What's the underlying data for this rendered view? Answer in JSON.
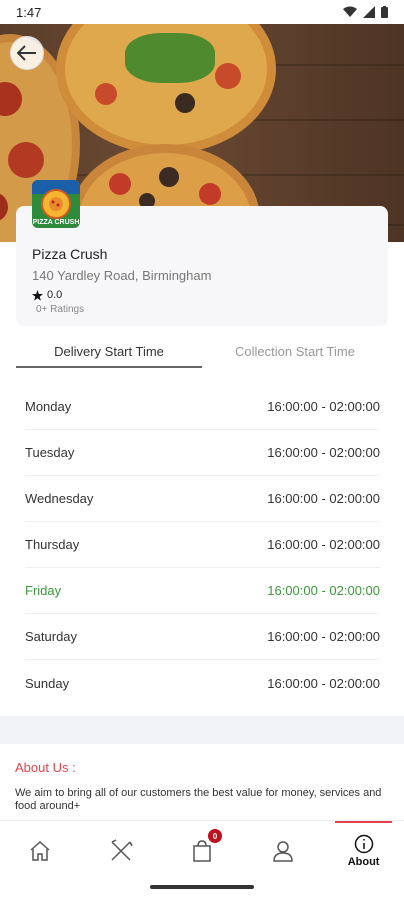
{
  "status_bar": {
    "time": "1:47",
    "icons": [
      "wifi-icon",
      "signal-icon",
      "battery-icon"
    ]
  },
  "hero": {
    "image": "pizza-banner",
    "back_icon": "arrow-left-icon"
  },
  "restaurant": {
    "logo_text": "PIZZA CRUSH",
    "name": "Pizza Crush",
    "address": "140 Yardley Road, Birmingham",
    "rating": "0.0",
    "ratings_count": "0+ Ratings"
  },
  "tabs": [
    {
      "label": "Delivery Start Time",
      "active": true
    },
    {
      "label": "Collection Start Time",
      "active": false
    }
  ],
  "hours": [
    {
      "day": "Monday",
      "time": "16:00:00 - 02:00:00",
      "today": false
    },
    {
      "day": "Tuesday",
      "time": "16:00:00 - 02:00:00",
      "today": false
    },
    {
      "day": "Wednesday",
      "time": "16:00:00 - 02:00:00",
      "today": false
    },
    {
      "day": "Thursday",
      "time": "16:00:00 - 02:00:00",
      "today": false
    },
    {
      "day": "Friday",
      "time": "16:00:00 - 02:00:00",
      "today": true
    },
    {
      "day": "Saturday",
      "time": "16:00:00 - 02:00:00",
      "today": false
    },
    {
      "day": "Sunday",
      "time": "16:00:00 - 02:00:00",
      "today": false
    }
  ],
  "about": {
    "title": "About Us :",
    "text": "We aim to bring all of our customers the best value for money, services and food around+"
  },
  "bottom_nav": {
    "cart_count": "0",
    "about_label": "About",
    "items": [
      "home-icon",
      "menu-icon",
      "cart-icon",
      "profile-icon",
      "info-icon"
    ]
  },
  "colors": {
    "accent": "#e0434b",
    "today": "#3a9a3a",
    "badge": "#c0121e"
  }
}
